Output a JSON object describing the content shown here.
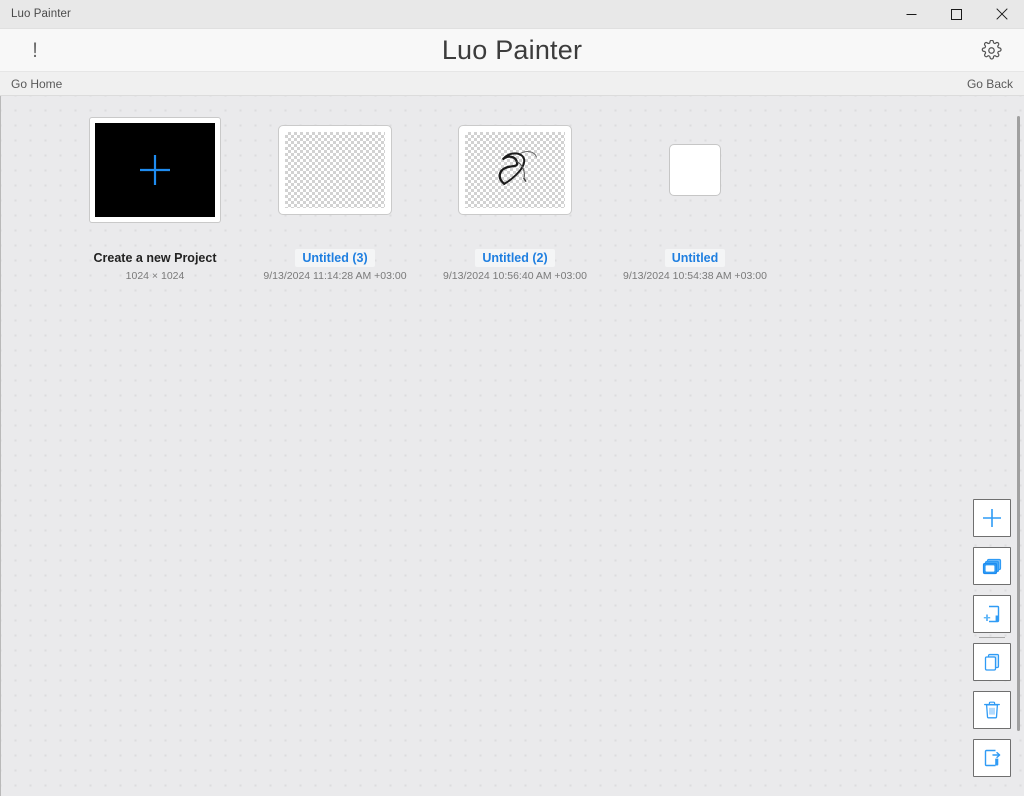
{
  "window": {
    "title": "Luo Painter",
    "controls": {
      "minimize": "minimize-button",
      "maximize": "maximize-button",
      "close": "close-button"
    }
  },
  "header": {
    "info_icon": "exclamation-icon",
    "app_title": "Luo Painter",
    "settings_icon": "gear-icon"
  },
  "nav": {
    "home_label": "Go Home",
    "back_label": "Go Back"
  },
  "colors": {
    "accent": "#1f7fe0",
    "icon_blue": "#2f9bf5",
    "canvas_bg": "#eaeaec",
    "dot": "#dcdcde",
    "title_bar": "#e8e8e8"
  },
  "projects": [
    {
      "kind": "new",
      "name": "Create a new Project",
      "subtitle": "1024 × 1024",
      "thumb": "black-canvas-with-plus"
    },
    {
      "kind": "project",
      "name": "Untitled (3)",
      "subtitle": "9/13/2024 11:14:28 AM +03:00",
      "thumb": "transparent-checkerboard"
    },
    {
      "kind": "project",
      "name": "Untitled (2)",
      "subtitle": "9/13/2024 10:56:40 AM +03:00",
      "thumb": "transparent-checkerboard-with-sketch"
    },
    {
      "kind": "project",
      "name": "Untitled",
      "subtitle": "9/13/2024 10:54:38 AM +03:00",
      "thumb": "white-square"
    }
  ],
  "toolbar": {
    "buttons": [
      {
        "id": "add",
        "icon": "plus-icon",
        "label": "Add"
      },
      {
        "id": "duplicate-project",
        "icon": "layers-icon",
        "label": "Duplicate Project"
      },
      {
        "id": "new-page",
        "icon": "add-page-icon",
        "label": "New Page"
      },
      {
        "id": "copy",
        "icon": "copy-icon",
        "label": "Copy"
      },
      {
        "id": "delete",
        "icon": "trash-icon",
        "label": "Delete"
      },
      {
        "id": "export",
        "icon": "export-icon",
        "label": "Export"
      }
    ]
  },
  "scrollbar": {
    "orientation": "vertical"
  }
}
